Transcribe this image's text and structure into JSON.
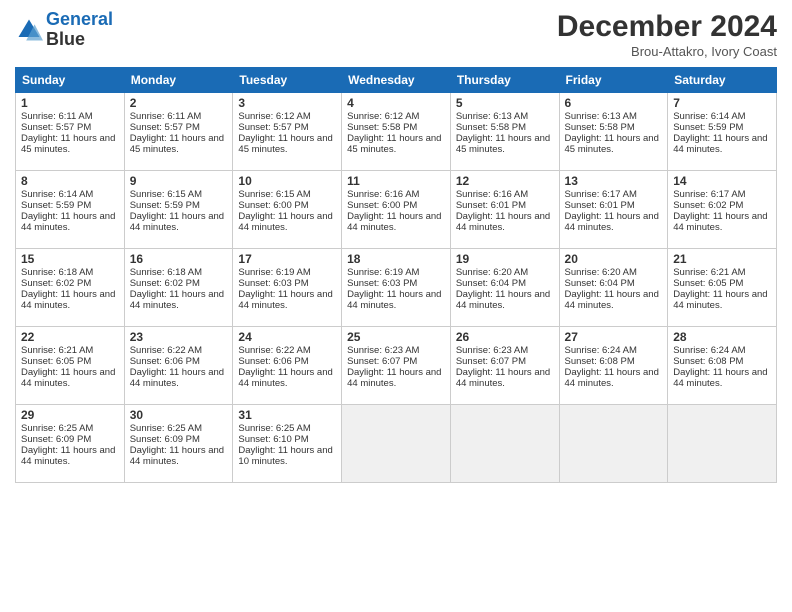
{
  "header": {
    "logo_line1": "General",
    "logo_line2": "Blue",
    "month": "December 2024",
    "location": "Brou-Attakro, Ivory Coast"
  },
  "weekdays": [
    "Sunday",
    "Monday",
    "Tuesday",
    "Wednesday",
    "Thursday",
    "Friday",
    "Saturday"
  ],
  "weeks": [
    [
      {
        "day": "1",
        "sunrise": "6:11 AM",
        "sunset": "5:57 PM",
        "daylight": "11 hours and 45 minutes."
      },
      {
        "day": "2",
        "sunrise": "6:11 AM",
        "sunset": "5:57 PM",
        "daylight": "11 hours and 45 minutes."
      },
      {
        "day": "3",
        "sunrise": "6:12 AM",
        "sunset": "5:57 PM",
        "daylight": "11 hours and 45 minutes."
      },
      {
        "day": "4",
        "sunrise": "6:12 AM",
        "sunset": "5:58 PM",
        "daylight": "11 hours and 45 minutes."
      },
      {
        "day": "5",
        "sunrise": "6:13 AM",
        "sunset": "5:58 PM",
        "daylight": "11 hours and 45 minutes."
      },
      {
        "day": "6",
        "sunrise": "6:13 AM",
        "sunset": "5:58 PM",
        "daylight": "11 hours and 45 minutes."
      },
      {
        "day": "7",
        "sunrise": "6:14 AM",
        "sunset": "5:59 PM",
        "daylight": "11 hours and 44 minutes."
      }
    ],
    [
      {
        "day": "8",
        "sunrise": "6:14 AM",
        "sunset": "5:59 PM",
        "daylight": "11 hours and 44 minutes."
      },
      {
        "day": "9",
        "sunrise": "6:15 AM",
        "sunset": "5:59 PM",
        "daylight": "11 hours and 44 minutes."
      },
      {
        "day": "10",
        "sunrise": "6:15 AM",
        "sunset": "6:00 PM",
        "daylight": "11 hours and 44 minutes."
      },
      {
        "day": "11",
        "sunrise": "6:16 AM",
        "sunset": "6:00 PM",
        "daylight": "11 hours and 44 minutes."
      },
      {
        "day": "12",
        "sunrise": "6:16 AM",
        "sunset": "6:01 PM",
        "daylight": "11 hours and 44 minutes."
      },
      {
        "day": "13",
        "sunrise": "6:17 AM",
        "sunset": "6:01 PM",
        "daylight": "11 hours and 44 minutes."
      },
      {
        "day": "14",
        "sunrise": "6:17 AM",
        "sunset": "6:02 PM",
        "daylight": "11 hours and 44 minutes."
      }
    ],
    [
      {
        "day": "15",
        "sunrise": "6:18 AM",
        "sunset": "6:02 PM",
        "daylight": "11 hours and 44 minutes."
      },
      {
        "day": "16",
        "sunrise": "6:18 AM",
        "sunset": "6:02 PM",
        "daylight": "11 hours and 44 minutes."
      },
      {
        "day": "17",
        "sunrise": "6:19 AM",
        "sunset": "6:03 PM",
        "daylight": "11 hours and 44 minutes."
      },
      {
        "day": "18",
        "sunrise": "6:19 AM",
        "sunset": "6:03 PM",
        "daylight": "11 hours and 44 minutes."
      },
      {
        "day": "19",
        "sunrise": "6:20 AM",
        "sunset": "6:04 PM",
        "daylight": "11 hours and 44 minutes."
      },
      {
        "day": "20",
        "sunrise": "6:20 AM",
        "sunset": "6:04 PM",
        "daylight": "11 hours and 44 minutes."
      },
      {
        "day": "21",
        "sunrise": "6:21 AM",
        "sunset": "6:05 PM",
        "daylight": "11 hours and 44 minutes."
      }
    ],
    [
      {
        "day": "22",
        "sunrise": "6:21 AM",
        "sunset": "6:05 PM",
        "daylight": "11 hours and 44 minutes."
      },
      {
        "day": "23",
        "sunrise": "6:22 AM",
        "sunset": "6:06 PM",
        "daylight": "11 hours and 44 minutes."
      },
      {
        "day": "24",
        "sunrise": "6:22 AM",
        "sunset": "6:06 PM",
        "daylight": "11 hours and 44 minutes."
      },
      {
        "day": "25",
        "sunrise": "6:23 AM",
        "sunset": "6:07 PM",
        "daylight": "11 hours and 44 minutes."
      },
      {
        "day": "26",
        "sunrise": "6:23 AM",
        "sunset": "6:07 PM",
        "daylight": "11 hours and 44 minutes."
      },
      {
        "day": "27",
        "sunrise": "6:24 AM",
        "sunset": "6:08 PM",
        "daylight": "11 hours and 44 minutes."
      },
      {
        "day": "28",
        "sunrise": "6:24 AM",
        "sunset": "6:08 PM",
        "daylight": "11 hours and 44 minutes."
      }
    ],
    [
      {
        "day": "29",
        "sunrise": "6:25 AM",
        "sunset": "6:09 PM",
        "daylight": "11 hours and 44 minutes."
      },
      {
        "day": "30",
        "sunrise": "6:25 AM",
        "sunset": "6:09 PM",
        "daylight": "11 hours and 44 minutes."
      },
      {
        "day": "31",
        "sunrise": "6:25 AM",
        "sunset": "6:10 PM",
        "daylight": "11 hours and 10 minutes."
      },
      null,
      null,
      null,
      null
    ]
  ]
}
